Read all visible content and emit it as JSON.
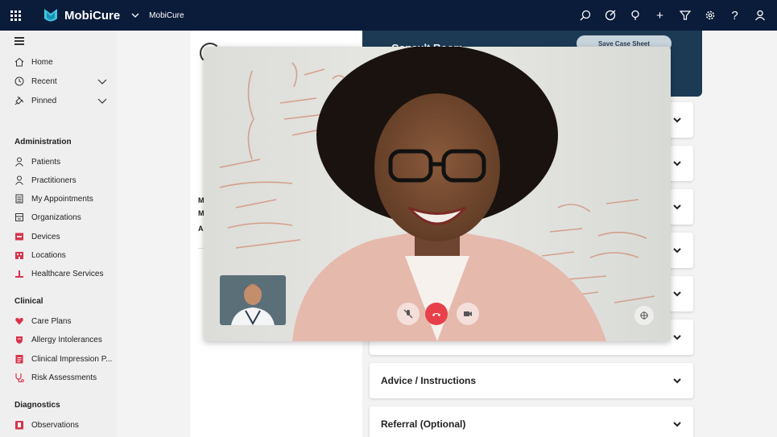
{
  "topbar": {
    "app_name": "MobiCure",
    "context_name": "MobiCure",
    "icons": [
      "search-icon",
      "target-icon",
      "lightbulb-icon",
      "plus-icon",
      "filter-icon",
      "gear-icon",
      "help-icon",
      "user-icon"
    ],
    "help_glyph": "?",
    "plus_glyph": "+",
    "bg_color": "#0b1b3a"
  },
  "sidebar": {
    "top_items": [
      {
        "label": "Home",
        "icon": "home-icon"
      },
      {
        "label": "Recent",
        "icon": "clock-icon"
      },
      {
        "label": "Pinned",
        "icon": "pin-icon"
      }
    ],
    "sections": [
      {
        "title": "Administration",
        "items": [
          {
            "label": "Patients",
            "icon": "person-icon"
          },
          {
            "label": "Practitioners",
            "icon": "person-icon"
          },
          {
            "label": "My Appointments",
            "icon": "calendar-icon"
          },
          {
            "label": "Organizations",
            "icon": "building-icon"
          },
          {
            "label": "Devices",
            "icon": "device-icon"
          },
          {
            "label": "Locations",
            "icon": "location-icon"
          },
          {
            "label": "Healthcare Services",
            "icon": "service-icon"
          }
        ]
      },
      {
        "title": "Clinical",
        "items": [
          {
            "label": "Care Plans",
            "icon": "heart-icon"
          },
          {
            "label": "Allergy Intolerances",
            "icon": "allergy-icon"
          },
          {
            "label": "Clinical Impression P...",
            "icon": "clipboard-icon"
          },
          {
            "label": "Risk Assessments",
            "icon": "stethoscope-icon"
          }
        ]
      },
      {
        "title": "Diagnostics",
        "items": [
          {
            "label": "Observations",
            "icon": "observation-icon"
          }
        ]
      }
    ]
  },
  "main": {
    "side_letters": [
      "M",
      "M",
      "A"
    ],
    "consult": {
      "title": "Consult Room",
      "save_label": "Save Case Sheet",
      "header_color": "#1d3a55"
    },
    "accordions": [
      {
        "label": ""
      },
      {
        "label": ""
      },
      {
        "label": ""
      },
      {
        "label": ""
      },
      {
        "label": ""
      },
      {
        "label": ""
      },
      {
        "label": "Advice / Instructions"
      },
      {
        "label": "Referral (Optional)"
      }
    ]
  },
  "video_call": {
    "controls": [
      "mute-mic-icon",
      "end-call-icon",
      "camera-off-icon",
      "fullscreen-icon"
    ],
    "end_call_color": "#e8404a"
  }
}
